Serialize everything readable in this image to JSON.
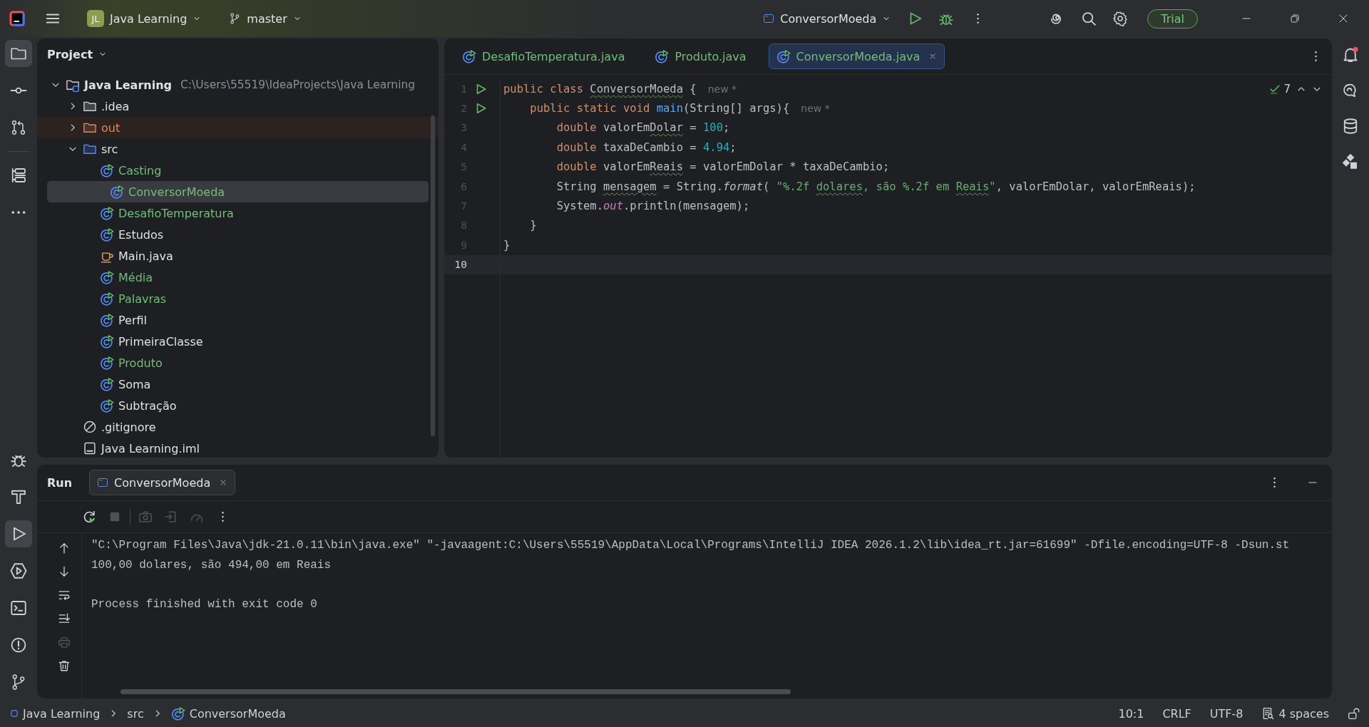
{
  "title_bar": {
    "project": {
      "badge": "JL",
      "name": "Java Learning"
    },
    "branch": "master",
    "run_config": "ConversorMoeda",
    "trial": "Trial"
  },
  "left_tools": [
    {
      "selected": true
    },
    {
      "selected": false
    },
    {
      "selected": false
    },
    {
      "selected": false
    },
    {
      "selected": false
    }
  ],
  "left_tools_bottom": [
    {
      "selected": false
    },
    {
      "selected": false
    },
    {
      "selected": true
    },
    {
      "selected": false
    },
    {
      "selected": false
    },
    {
      "selected": false
    },
    {
      "selected": false
    }
  ],
  "project_panel": {
    "title": "Project",
    "tree": [
      {
        "kind": "root",
        "label": "Java Learning",
        "path": "C:\\Users\\55519\\IdeaProjects\\Java Learning",
        "added": false,
        "excluded": false,
        "expanded": true,
        "selected": false,
        "children": [
          {
            "kind": "folder",
            "label": ".idea",
            "added": false,
            "excluded": false,
            "expanded": false,
            "selected": false
          },
          {
            "kind": "folder",
            "label": "out",
            "added": false,
            "excluded": true,
            "expanded": false,
            "selected": false
          },
          {
            "kind": "source-folder",
            "label": "src",
            "added": false,
            "excluded": false,
            "expanded": true,
            "selected": false,
            "children": [
              {
                "kind": "class",
                "label": "Casting",
                "added": true,
                "excluded": false,
                "selected": false
              },
              {
                "kind": "class",
                "label": "ConversorMoeda",
                "added": true,
                "excluded": false,
                "selected": true
              },
              {
                "kind": "class",
                "label": "DesafioTemperatura",
                "added": true,
                "excluded": false,
                "selected": false
              },
              {
                "kind": "class",
                "label": "Estudos",
                "added": false,
                "excluded": false,
                "selected": false
              },
              {
                "kind": "java-file",
                "label": "Main.java",
                "added": false,
                "excluded": false,
                "selected": false
              },
              {
                "kind": "class",
                "label": "Média",
                "added": true,
                "excluded": false,
                "selected": false
              },
              {
                "kind": "class",
                "label": "Palavras",
                "added": true,
                "excluded": false,
                "selected": false
              },
              {
                "kind": "class",
                "label": "Perfil",
                "added": false,
                "excluded": false,
                "selected": false
              },
              {
                "kind": "class",
                "label": "PrimeiraClasse",
                "added": false,
                "excluded": false,
                "selected": false
              },
              {
                "kind": "class",
                "label": "Produto",
                "added": true,
                "excluded": false,
                "selected": false
              },
              {
                "kind": "class",
                "label": "Soma",
                "added": false,
                "excluded": false,
                "selected": false
              },
              {
                "kind": "class",
                "label": "Subtração",
                "added": false,
                "excluded": false,
                "selected": false
              }
            ]
          },
          {
            "kind": "ignore-file",
            "label": ".gitignore",
            "added": false,
            "excluded": false,
            "selected": false
          },
          {
            "kind": "module-file",
            "label": "Java Learning.iml",
            "added": false,
            "excluded": false,
            "selected": false
          }
        ]
      }
    ]
  },
  "editor": {
    "tabs": [
      {
        "label": "DesafioTemperatura.java",
        "added": true,
        "selected": false
      },
      {
        "label": "Produto.java",
        "added": true,
        "selected": false
      },
      {
        "label": "ConversorMoeda.java",
        "added": true,
        "selected": true
      }
    ],
    "problems": "7",
    "lines": [
      {
        "number": "1",
        "runnable": true,
        "current": false,
        "hint": "new *",
        "tokens": [
          {
            "t": "public ",
            "kind": "keyword"
          },
          {
            "t": "class ",
            "kind": "keyword"
          },
          {
            "t": "ConversorMoeda",
            "kind": "plain",
            "warn": true
          },
          {
            "t": " {",
            "kind": "plain"
          }
        ]
      },
      {
        "number": "2",
        "runnable": true,
        "current": false,
        "hint": "new *",
        "tokens": [
          {
            "t": "    public static void ",
            "kind": "keyword"
          },
          {
            "t": "main",
            "kind": "method"
          },
          {
            "t": "(String[] args){",
            "kind": "plain"
          }
        ]
      },
      {
        "number": "3",
        "runnable": false,
        "current": false,
        "tokens": [
          {
            "t": "        double ",
            "kind": "keyword"
          },
          {
            "t": "valorEm",
            "kind": "plain"
          },
          {
            "t": "Dolar",
            "kind": "plain",
            "warn": true
          },
          {
            "t": " = ",
            "kind": "plain"
          },
          {
            "t": "100",
            "kind": "number"
          },
          {
            "t": ";",
            "kind": "plain"
          }
        ]
      },
      {
        "number": "4",
        "runnable": false,
        "current": false,
        "tokens": [
          {
            "t": "        double ",
            "kind": "keyword"
          },
          {
            "t": "taxaDeCambio = ",
            "kind": "plain"
          },
          {
            "t": "4.94",
            "kind": "number"
          },
          {
            "t": ";",
            "kind": "plain"
          }
        ]
      },
      {
        "number": "5",
        "runnable": false,
        "current": false,
        "tokens": [
          {
            "t": "        double ",
            "kind": "keyword"
          },
          {
            "t": "valorEm",
            "kind": "plain"
          },
          {
            "t": "Reais",
            "kind": "plain",
            "warn": true
          },
          {
            "t": " = valorEmDolar * taxaDeCambio;",
            "kind": "plain"
          }
        ]
      },
      {
        "number": "6",
        "runnable": false,
        "current": false,
        "tokens": [
          {
            "t": "        String ",
            "kind": "plain"
          },
          {
            "t": "mensagem",
            "kind": "plain",
            "warn": true
          },
          {
            "t": " = String.",
            "kind": "plain"
          },
          {
            "t": "format",
            "kind": "call"
          },
          {
            "t": "( ",
            "kind": "plain"
          },
          {
            "t": "\"%.2f ",
            "kind": "string"
          },
          {
            "t": "dolares",
            "kind": "string",
            "warn": true
          },
          {
            "t": ", são %.2f em ",
            "kind": "string"
          },
          {
            "t": "Reais",
            "kind": "string",
            "warn": true
          },
          {
            "t": "\"",
            "kind": "string"
          },
          {
            "t": ", valorEmDolar, valorEmReais);",
            "kind": "plain"
          }
        ]
      },
      {
        "number": "7",
        "runnable": false,
        "current": false,
        "tokens": [
          {
            "t": "        System.",
            "kind": "plain"
          },
          {
            "t": "out",
            "kind": "field"
          },
          {
            "t": ".println(mensagem);",
            "kind": "plain"
          }
        ]
      },
      {
        "number": "8",
        "runnable": false,
        "current": false,
        "tokens": [
          {
            "t": "    }",
            "kind": "plain"
          }
        ]
      },
      {
        "number": "9",
        "runnable": false,
        "current": false,
        "tokens": [
          {
            "t": "}",
            "kind": "plain"
          }
        ]
      },
      {
        "number": "10",
        "runnable": false,
        "current": true
      }
    ]
  },
  "run_panel": {
    "title": "Run",
    "tab": {
      "label": "ConversorMoeda",
      "selected": true
    },
    "toolbar": [
      {
        "disabled": false
      },
      {
        "disabled": true
      },
      {
        "disabled": true
      },
      {
        "disabled": true
      },
      {
        "disabled": true
      }
    ],
    "side_toolbar": [
      {
        "disabled": false
      },
      {
        "disabled": false
      },
      {
        "disabled": false
      },
      {
        "disabled": false
      },
      {
        "disabled": true
      },
      {
        "disabled": false
      }
    ],
    "console": [
      {
        "text": "\"C:\\Program Files\\Java\\jdk-21.0.11\\bin\\java.exe\" \"-javaagent:C:\\Users\\55519\\AppData\\Local\\Programs\\IntelliJ IDEA 2026.1.2\\lib\\idea_rt.jar=61699\" -Dfile.encoding=UTF-8 -Dsun.st",
        "kind": "command"
      },
      {
        "text": "100,00 dolares, são 494,00 em Reais",
        "kind": "output"
      },
      {
        "text": "Process finished with exit code 0",
        "kind": "exit"
      }
    ]
  },
  "status_bar": {
    "breadcrumbs": [
      {
        "kind": "module",
        "label": "Java Learning"
      },
      {
        "kind": "folder",
        "label": "src"
      },
      {
        "kind": "class",
        "label": "ConversorMoeda"
      }
    ],
    "position": "10:1",
    "line_separator": "CRLF",
    "encoding": "UTF-8",
    "indent": "4 spaces"
  }
}
